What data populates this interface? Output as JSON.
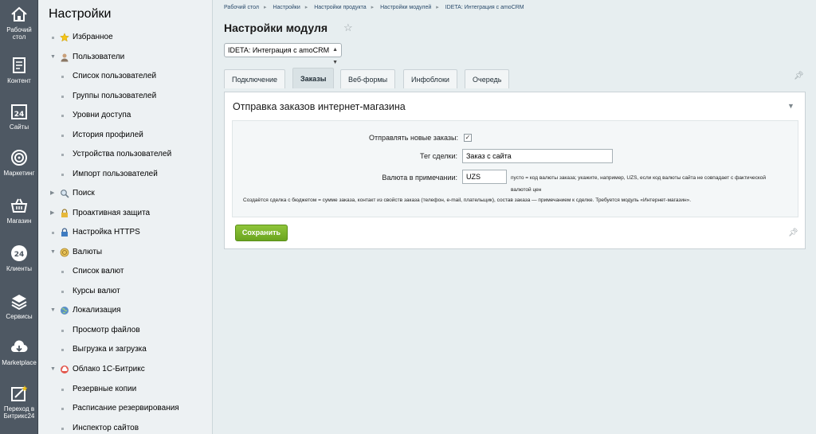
{
  "rail": [
    {
      "label": "Рабочий стол",
      "icon": "home-icon"
    },
    {
      "label": "Контент",
      "icon": "document-icon"
    },
    {
      "label": "Сайты",
      "icon": "calendar-24-icon"
    },
    {
      "label": "Маркетинг",
      "icon": "target-icon"
    },
    {
      "label": "Магазин",
      "icon": "basket-icon"
    },
    {
      "label": "Клиенты",
      "icon": "clients-24-icon"
    },
    {
      "label": "Сервисы",
      "icon": "layers-icon"
    },
    {
      "label": "Marketplace",
      "icon": "cloud-download-icon"
    },
    {
      "label": "Переход в Битрикс24",
      "icon": "bitrix24-edit-icon"
    }
  ],
  "nav": {
    "title": "Настройки",
    "items": [
      {
        "label": "Избранное",
        "type": "section",
        "expander": "bullet",
        "icon": "star-icon"
      },
      {
        "label": "Пользователи",
        "type": "section",
        "expander": "open",
        "icon": "user-icon"
      },
      {
        "label": "Список пользователей",
        "type": "child"
      },
      {
        "label": "Группы пользователей",
        "type": "child"
      },
      {
        "label": "Уровни доступа",
        "type": "child"
      },
      {
        "label": "История профилей",
        "type": "child"
      },
      {
        "label": "Устройства пользователей",
        "type": "child"
      },
      {
        "label": "Импорт пользователей",
        "type": "child"
      },
      {
        "label": "Поиск",
        "type": "section",
        "expander": "closed",
        "icon": "magnifier-icon"
      },
      {
        "label": "Проактивная защита",
        "type": "section",
        "expander": "closed",
        "icon": "lock-icon"
      },
      {
        "label": "Настройка HTTPS",
        "type": "section",
        "expander": "bullet",
        "icon": "https-lock-icon"
      },
      {
        "label": "Валюты",
        "type": "section",
        "expander": "open",
        "icon": "currency-icon"
      },
      {
        "label": "Список валют",
        "type": "child"
      },
      {
        "label": "Курсы валют",
        "type": "child"
      },
      {
        "label": "Локализация",
        "type": "section",
        "expander": "open",
        "icon": "globe-icon"
      },
      {
        "label": "Просмотр файлов",
        "type": "child"
      },
      {
        "label": "Выгрузка и загрузка",
        "type": "child"
      },
      {
        "label": "Облако 1С-Битрикс",
        "type": "section",
        "expander": "open",
        "icon": "cloud-icon"
      },
      {
        "label": "Резервные копии",
        "type": "child"
      },
      {
        "label": "Расписание резервирования",
        "type": "child"
      },
      {
        "label": "Инспектор сайтов",
        "type": "child"
      }
    ]
  },
  "breadcrumbs": [
    "Рабочий стол",
    "Настройки",
    "Настройки продукта",
    "Настройки модулей",
    "IDETA: Интеграция с amoCRM"
  ],
  "page": {
    "title": "Настройки модуля",
    "module_select": "IDETA: Интеграция с amoCRM"
  },
  "tabs": [
    {
      "label": "Подключение",
      "active": false
    },
    {
      "label": "Заказы",
      "active": true
    },
    {
      "label": "Веб-формы",
      "active": false
    },
    {
      "label": "Инфоблоки",
      "active": false
    },
    {
      "label": "Очередь",
      "active": false
    }
  ],
  "panel": {
    "title": "Отправка заказов интернет-магазина",
    "fields": {
      "send_label": "Отправлять новые заказы:",
      "send_checked": true,
      "tag_label": "Тег сделки:",
      "tag_value": "Заказ с сайта",
      "currency_label": "Валюта в примечании:",
      "currency_value": "UZS",
      "currency_hint": "пусто = код валюты заказа; укажите, например, UZS, если код валюты сайта не совпадает с фактической валютой цен"
    },
    "note": "Создаётся сделка с бюджетом = сумме заказа, контакт из свойств заказа (телефон, e-mail, плательщик), состав заказа — примечанием к сделке. Требуется модуль «Интернет-магазин».",
    "save_label": "Сохранить"
  },
  "colors": {
    "rail_bg": "#4e5863",
    "nav_bg": "#edf1f3",
    "main_bg": "#e7eef0",
    "save_button": "#7ab32e",
    "link": "#2a4b6b"
  }
}
